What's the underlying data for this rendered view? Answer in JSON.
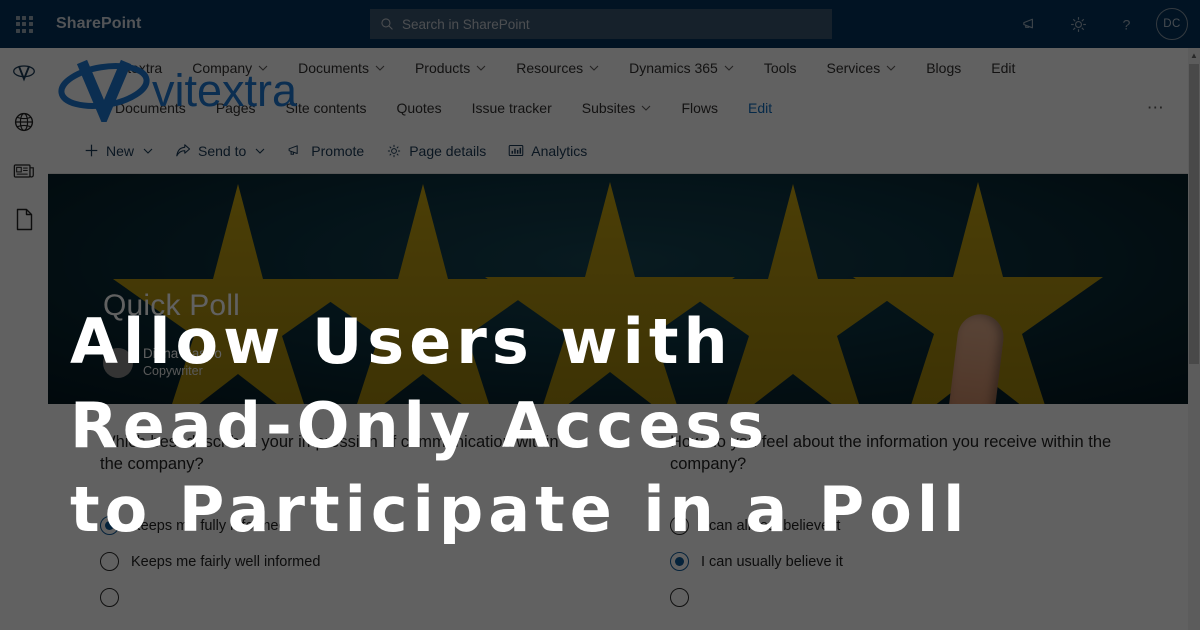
{
  "suite": {
    "waffle_icon": "app-launcher-icon",
    "title": "SharePoint",
    "search_placeholder": "Search in SharePoint",
    "search_icon": "search-icon",
    "icons": [
      {
        "name": "megaphone-icon",
        "label": "Promote"
      },
      {
        "name": "gear-icon",
        "label": "Settings"
      },
      {
        "name": "question-icon",
        "label": "Help"
      }
    ],
    "avatar_initials": "DC"
  },
  "rail": {
    "items": [
      {
        "icon": "vitextra-site-logo-icon",
        "label": "Vitextra"
      },
      {
        "icon": "globe-icon",
        "label": "Site"
      },
      {
        "icon": "news-icon",
        "label": "News"
      },
      {
        "icon": "page-icon",
        "label": "Page"
      }
    ]
  },
  "logo": {
    "wordmark": "vitextra",
    "color": "#1f7ad4"
  },
  "topnav": {
    "items": [
      {
        "label": "Vitextra",
        "has_chevron": false
      },
      {
        "label": "Company",
        "has_chevron": true
      },
      {
        "label": "Documents",
        "has_chevron": true
      },
      {
        "label": "Products",
        "has_chevron": true
      },
      {
        "label": "Resources",
        "has_chevron": true
      },
      {
        "label": "Dynamics 365",
        "has_chevron": true
      },
      {
        "label": "Tools",
        "has_chevron": false
      },
      {
        "label": "Services",
        "has_chevron": true
      },
      {
        "label": "Blogs",
        "has_chevron": false
      },
      {
        "label": "Edit",
        "has_chevron": false
      }
    ]
  },
  "subnav": {
    "items": [
      {
        "label": "Documents",
        "has_chevron": false,
        "accent": false
      },
      {
        "label": "Pages",
        "has_chevron": false,
        "accent": false
      },
      {
        "label": "Site contents",
        "has_chevron": false,
        "accent": false
      },
      {
        "label": "Quotes",
        "has_chevron": false,
        "accent": false
      },
      {
        "label": "Issue tracker",
        "has_chevron": false,
        "accent": false
      },
      {
        "label": "Subsites",
        "has_chevron": true,
        "accent": false
      },
      {
        "label": "Flows",
        "has_chevron": false,
        "accent": false
      },
      {
        "label": "Edit",
        "has_chevron": false,
        "accent": true
      }
    ],
    "overflow_label": "⋯"
  },
  "commandbar": {
    "items": [
      {
        "label": "New",
        "icon": "plus-icon",
        "has_chevron": true
      },
      {
        "label": "Send to",
        "icon": "send-to-icon",
        "has_chevron": true
      },
      {
        "label": "Promote",
        "icon": "megaphone-icon",
        "has_chevron": false
      },
      {
        "label": "Page details",
        "icon": "gear-icon",
        "has_chevron": false
      },
      {
        "label": "Analytics",
        "icon": "analytics-icon",
        "has_chevron": false
      }
    ]
  },
  "hero": {
    "title": "Quick Poll",
    "author": "Diana Castro",
    "role": "Copywriter",
    "image_description": "five-gold-stars-with-finger",
    "star_count": 5,
    "star_color": "#b79a12",
    "background_color": "#0d3442"
  },
  "polls": [
    {
      "question": "Which best describes your impression of communication within the company?",
      "options": [
        {
          "label": "Keeps me fully informed",
          "selected": true
        },
        {
          "label": "Keeps me fairly well informed",
          "selected": false
        },
        {
          "label": "",
          "selected": false
        }
      ]
    },
    {
      "question": "How do you feel about the information you receive within the company?",
      "options": [
        {
          "label": "I can almost believe it",
          "selected": false
        },
        {
          "label": "I can usually believe it",
          "selected": true
        },
        {
          "label": "",
          "selected": false
        }
      ]
    }
  ],
  "overlay": {
    "line1": "Allow Users with",
    "line2": "Read-Only Access",
    "line3": "to Participate in a Poll"
  },
  "scrollbar": {
    "up_arrow": "▲"
  }
}
